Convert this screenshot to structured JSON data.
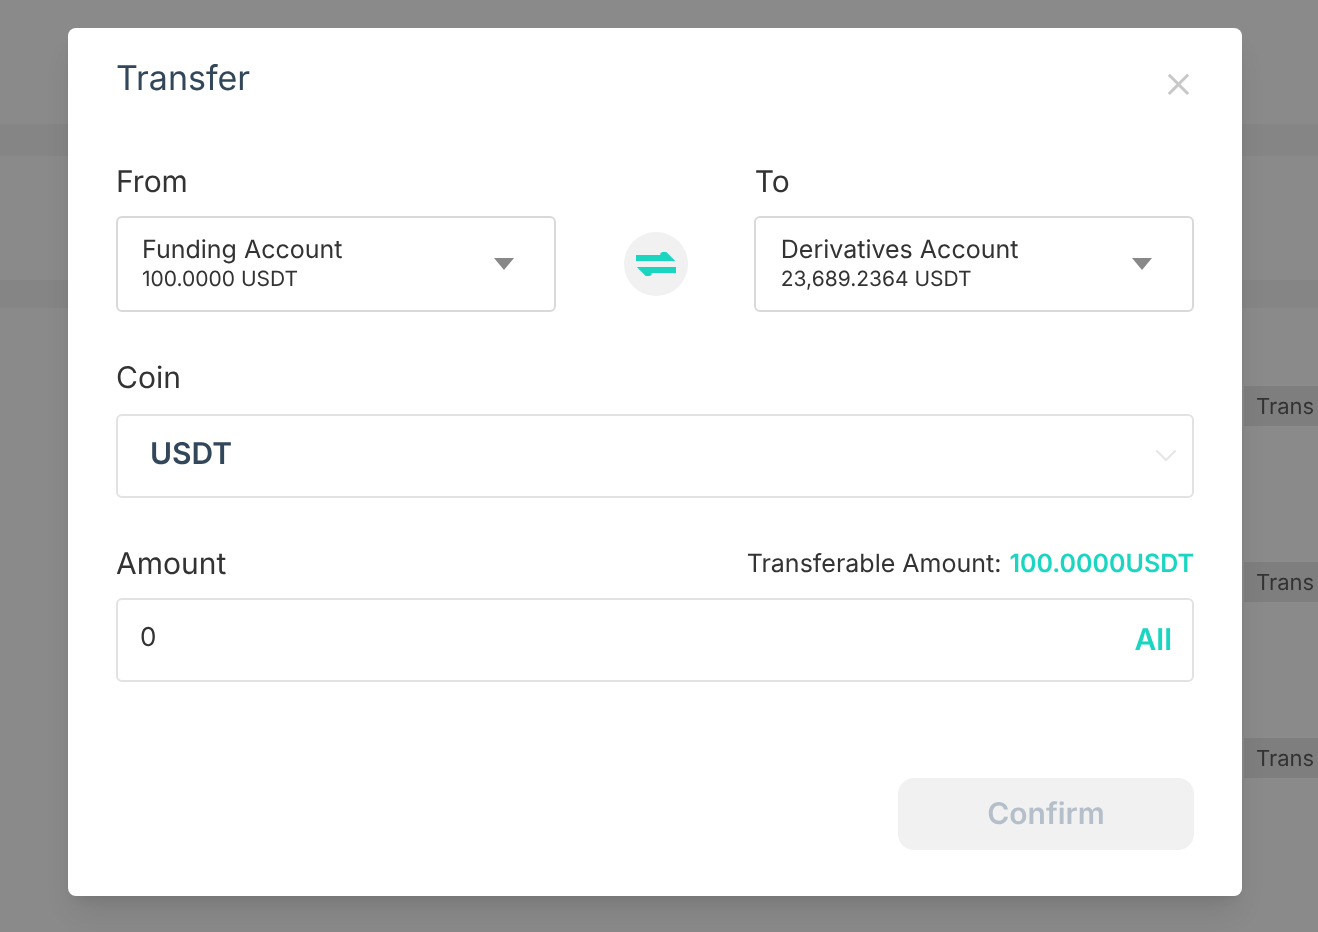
{
  "background": {
    "row_buttons": [
      "Trans",
      "Trans",
      "Trans"
    ]
  },
  "dialog": {
    "title": "Transfer",
    "close": "×",
    "from": {
      "label": "From",
      "account": "Funding Account",
      "balance": "100.0000 USDT"
    },
    "to": {
      "label": "To",
      "account": "Derivatives Account",
      "balance": "23,689.2364 USDT"
    },
    "coin": {
      "label": "Coin",
      "value": "USDT"
    },
    "amount": {
      "label": "Amount",
      "available_label": "Transferable Amount:",
      "available_value": "100.0000USDT",
      "value": "0",
      "all": "All"
    },
    "confirm": {
      "label": "Confirm",
      "disabled": true
    }
  }
}
